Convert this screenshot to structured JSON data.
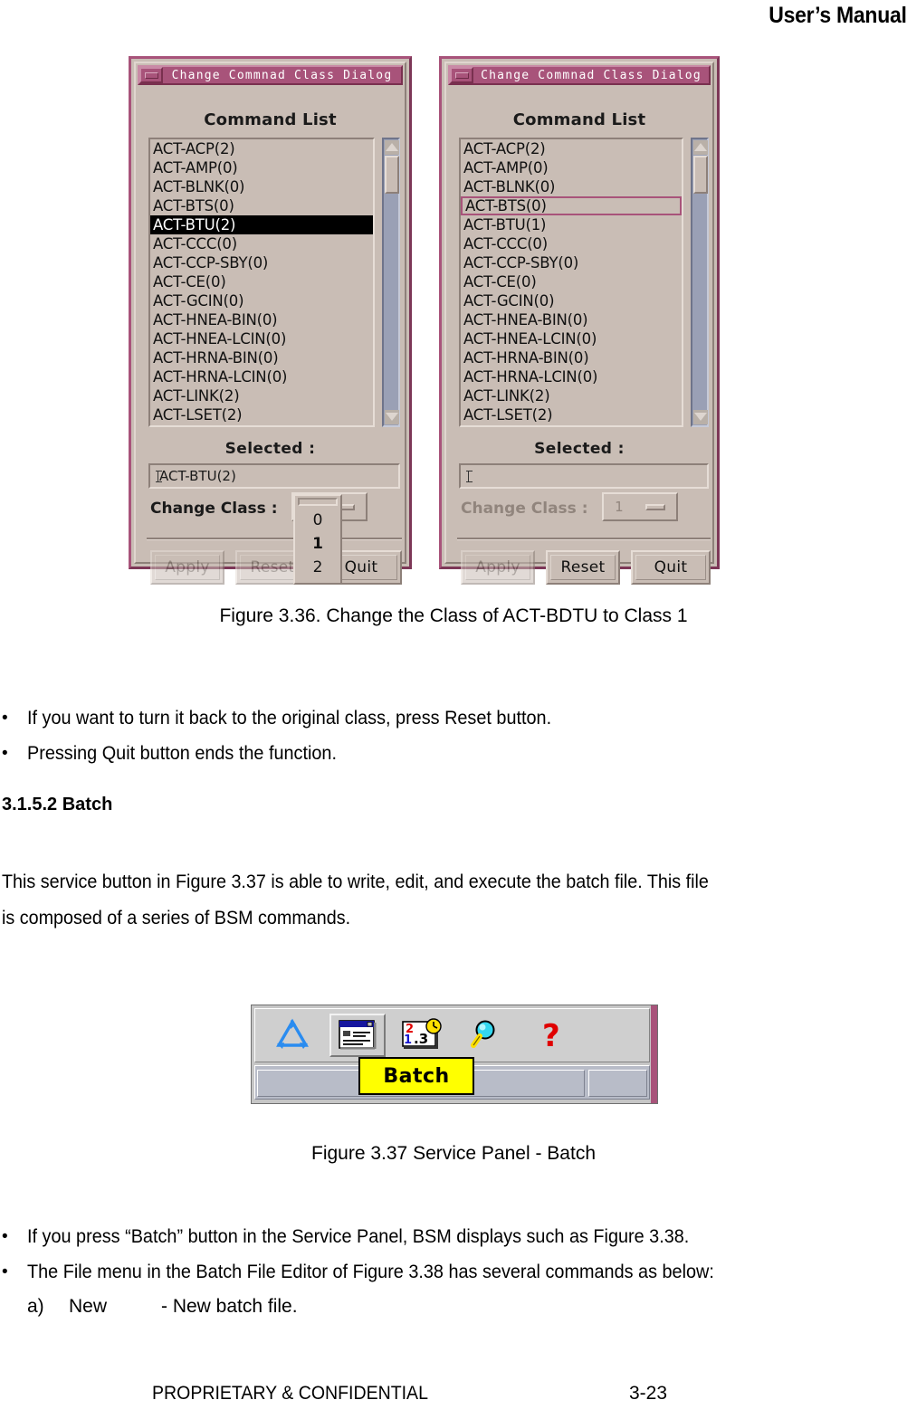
{
  "page": {
    "header": "User’s Manual",
    "footer_text": "PROPRIETARY & CONFIDENTIAL",
    "footer_page": "3-23"
  },
  "dialog_left": {
    "title": "Change Commnad Class Dialog",
    "minimize_icon": "minimize-icon",
    "section_label": "Command List",
    "items": [
      "ACT-ACP(2)",
      "ACT-AMP(0)",
      "ACT-BLNK(0)",
      "ACT-BTS(0)",
      "ACT-BTU(2)",
      "ACT-CCC(0)",
      "ACT-CCP-SBY(0)",
      "ACT-CE(0)",
      "ACT-GCIN(0)",
      "ACT-HNEA-BIN(0)",
      "ACT-HNEA-LCIN(0)",
      "ACT-HRNA-BIN(0)",
      "ACT-HRNA-LCIN(0)",
      "ACT-LINK(2)",
      "ACT-LSET(2)"
    ],
    "selected_index": 4,
    "selected_label": "Selected :",
    "selected_value": "ACT-BTU(2)",
    "change_class_label": "Change Class :",
    "change_class_value": "1",
    "class_options": [
      "0",
      "1",
      "2"
    ],
    "class_current": "1",
    "buttons": {
      "apply": "Apply",
      "reset": "Reset",
      "quit": "Quit"
    }
  },
  "dialog_right": {
    "title": "Change Commnad Class Dialog",
    "minimize_icon": "minimize-icon",
    "section_label": "Command List",
    "items": [
      "ACT-ACP(2)",
      "ACT-AMP(0)",
      "ACT-BLNK(0)",
      "ACT-BTS(0)",
      "ACT-BTU(1)",
      "ACT-CCC(0)",
      "ACT-CCP-SBY(0)",
      "ACT-CE(0)",
      "ACT-GCIN(0)",
      "ACT-HNEA-BIN(0)",
      "ACT-HNEA-LCIN(0)",
      "ACT-HRNA-BIN(0)",
      "ACT-HRNA-LCIN(0)",
      "ACT-LINK(2)",
      "ACT-LSET(2)"
    ],
    "focused_index": 3,
    "selected_label": "Selected :",
    "selected_value": "",
    "change_class_label": "Change Class :",
    "change_class_value": "1",
    "buttons": {
      "apply": "Apply",
      "reset": "Reset",
      "quit": "Quit"
    }
  },
  "figure_336_caption": "Figure 3.36. Change the Class of ACT-BDTU to Class 1",
  "bullets_1": [
    "If you want to turn it back to the original class, press Reset button.",
    "Pressing Quit button ends the function."
  ],
  "section_heading": "3.1.5.2 Batch",
  "paragraph_1": [
    "This service button in Figure 3.37 is able to write, edit, and execute the batch file. This file",
    "is composed of a series of BSM commands."
  ],
  "service_panel": {
    "tools": [
      {
        "name": "recycle-icon",
        "title": "recycle"
      },
      {
        "name": "batch-window-icon",
        "title": "Batch"
      },
      {
        "name": "scheduler-clock-icon",
        "title": "scheduler"
      },
      {
        "name": "magnifier-icon",
        "title": "search"
      },
      {
        "name": "help-question-icon",
        "title": "help"
      }
    ],
    "tooltip": "Batch",
    "pressed_tool_index": 1
  },
  "figure_337_caption": "Figure 3.37 Service Panel - Batch",
  "bullets_2": [
    "If you press “Batch” button in the Service Panel, BSM displays such as Figure 3.38.",
    "The File menu in the Batch File Editor of Figure 3.38 has several commands as below:"
  ],
  "sub_items": [
    {
      "label": "a)",
      "name": "New",
      "desc": "- New batch file."
    }
  ],
  "colors": {
    "title_bar": "#a8537a",
    "dialog_face": "#c9bdb5",
    "scrollbar_trough": "#9aa0b5",
    "tooltip_bg": "#ffff00",
    "selection_bg": "#000000"
  }
}
